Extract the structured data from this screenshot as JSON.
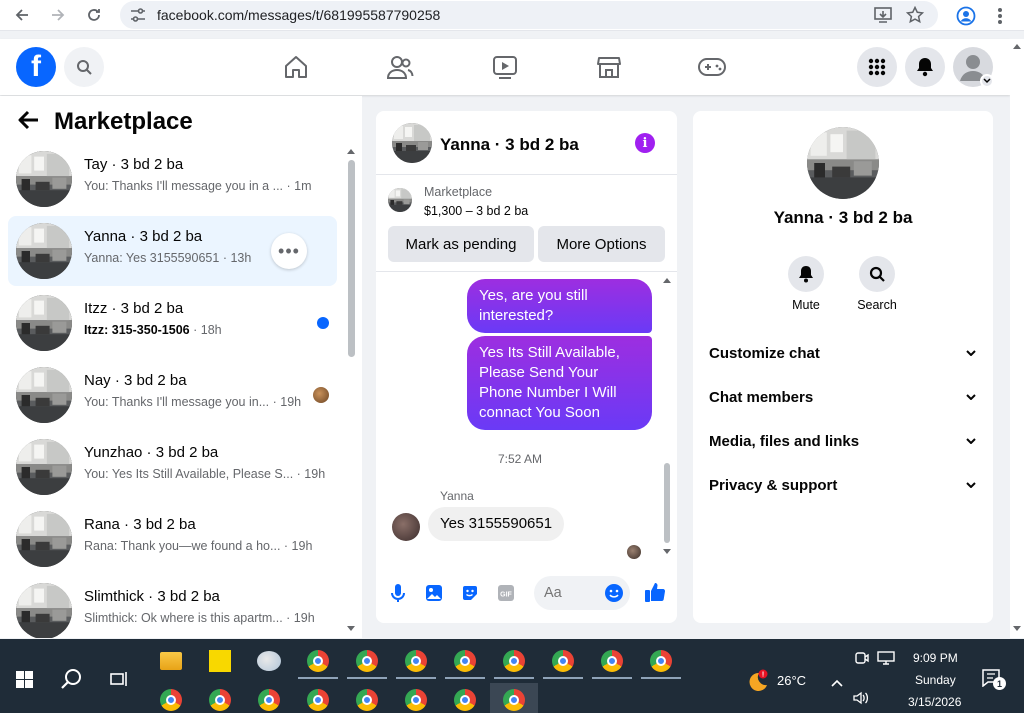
{
  "browser": {
    "url": "facebook.com/messages/t/681995587790258"
  },
  "left": {
    "title": "Marketplace",
    "conversations": [
      {
        "name": "Tay · 3 bd 2 ba",
        "preview": "You: Thanks I'll message you in a ...",
        "time": "· 1m",
        "bold": false
      },
      {
        "name": "Yanna · 3 bd 2 ba",
        "preview": "Yanna: Yes 3155590651",
        "time": "· 13h",
        "bold": false
      },
      {
        "name": "Itzz · 3 bd 2 ba",
        "preview": "Itzz: 315-350-1506",
        "time": "· 18h",
        "bold": true
      },
      {
        "name": "Nay · 3 bd 2 ba",
        "preview": "You: Thanks I'll message you in...",
        "time": "· 19h",
        "bold": false
      },
      {
        "name": "Yunzhao · 3 bd 2 ba",
        "preview": "You: Yes Its Still Available, Please S...",
        "time": "· 19h",
        "bold": false
      },
      {
        "name": "Rana · 3 bd 2 ba",
        "preview": "Rana: Thank you—we found a ho...",
        "time": "· 19h",
        "bold": false
      },
      {
        "name": "Slimthick · 3 bd 2 ba",
        "preview": "Slimthick: Ok where is this apartm...",
        "time": "· 19h",
        "bold": false
      }
    ]
  },
  "chat": {
    "title": "Yanna · 3 bd 2 ba",
    "listing_label": "Marketplace",
    "listing_price": "$1,300 – 3 bd 2 ba",
    "mark_pending": "Mark as pending",
    "more_options": "More Options",
    "msg1": "Yes, are you still interested?",
    "msg2": "Yes Its Still Available, Please Send Your Phone Number I Will connact You Soon",
    "timestamp": "7:52 AM",
    "sender": "Yanna",
    "msg3": "Yes 3155590651",
    "input_placeholder": "Aa"
  },
  "info": {
    "name": "Yanna · 3 bd 2 ba",
    "mute": "Mute",
    "search": "Search",
    "rows": [
      "Customize chat",
      "Chat members",
      "Media, files and links",
      "Privacy & support"
    ]
  },
  "taskbar": {
    "weather": "26°C",
    "time": "9:09 PM",
    "day": "Sunday",
    "date": "3/15/2026",
    "notif_count": "1"
  }
}
